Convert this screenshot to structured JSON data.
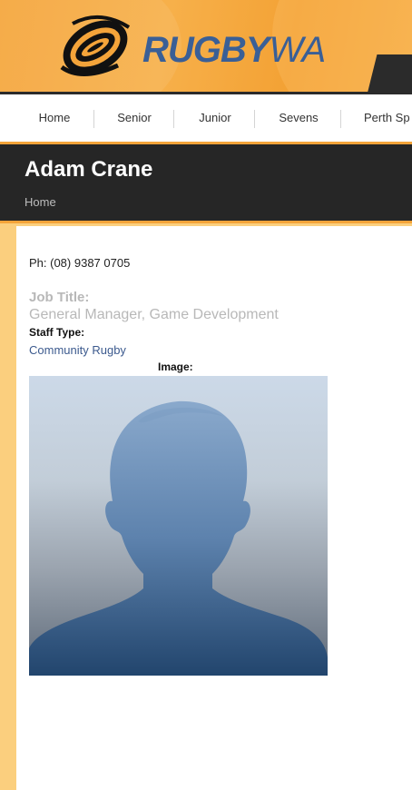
{
  "header": {
    "brand_primary": "RUGBY",
    "brand_secondary": "WA"
  },
  "nav": {
    "items": [
      {
        "label": "Home"
      },
      {
        "label": "Senior"
      },
      {
        "label": "Junior"
      },
      {
        "label": "Sevens"
      },
      {
        "label": "Perth Sp"
      }
    ]
  },
  "profile": {
    "name": "Adam Crane",
    "breadcrumb_home": "Home",
    "phone": "Ph: (08) 9387 0705",
    "job_title_label": "Job Title:",
    "job_title": "General Manager, Game Development",
    "staff_type_label": "Staff Type:",
    "staff_type": "Community Rugby",
    "image_label": "Image:"
  },
  "colors": {
    "brand_orange": "#f4a43a",
    "brand_blue": "#3a5f96",
    "dark_band": "#262626",
    "side_panel": "#fbcf7e",
    "link_blue": "#3c5a8e"
  },
  "icons": {
    "logo": "rugby-ball-swirl-icon",
    "photo_placeholder": "person-silhouette-icon"
  }
}
